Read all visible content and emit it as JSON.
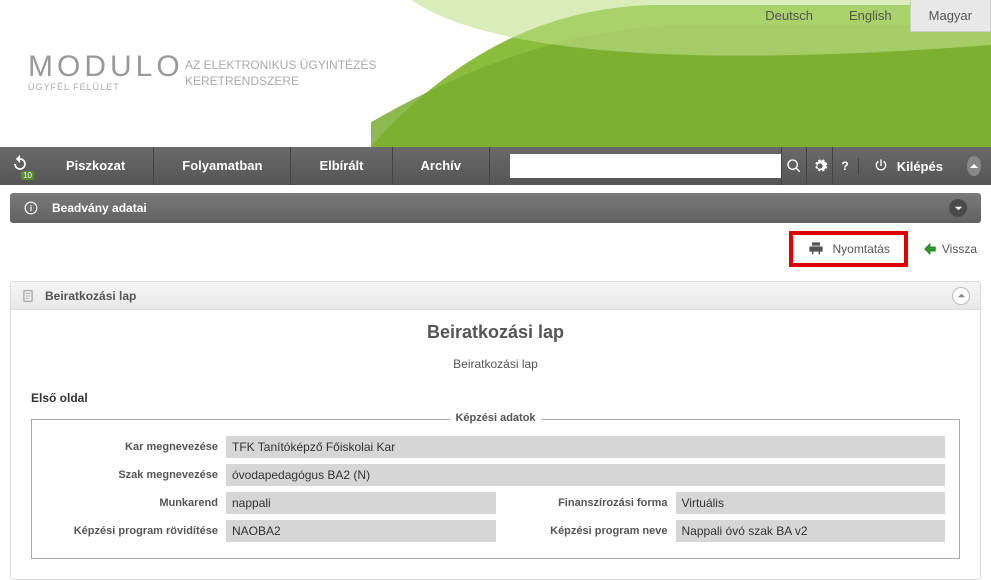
{
  "languages": {
    "de": "Deutsch",
    "en": "English",
    "hu": "Magyar",
    "active": "hu"
  },
  "logo": {
    "main": "MODULO",
    "sub": "ÜGYFÉL FELÜLET",
    "tagline_l1": "AZ ELEKTRONIKUS ÜGYINTÉZÉS",
    "tagline_l2": "KERETRENDSZERE"
  },
  "menu": {
    "items": [
      "Piszkozat",
      "Folyamatban",
      "Elbírált",
      "Archív"
    ],
    "logout": "Kilépés",
    "refresh_badge": "10",
    "search_value": ""
  },
  "section": {
    "title": "Beadvány adatai"
  },
  "actions": {
    "print": "Nyomtatás",
    "back": "Vissza"
  },
  "panel": {
    "title": "Beiratkozási lap"
  },
  "doc": {
    "title": "Beiratkozási lap",
    "subtitle": "Beiratkozási lap",
    "page_header": "Első oldal"
  },
  "fieldset": {
    "legend": "Képzési adatok"
  },
  "fields": {
    "kar": {
      "label": "Kar megnevezése",
      "value": "TFK Tanítóképző Főiskolai Kar"
    },
    "szak": {
      "label": "Szak megnevezése",
      "value": "óvodapedagógus BA2 (N)"
    },
    "munkarend": {
      "label": "Munkarend",
      "value": "nappali"
    },
    "finansz": {
      "label": "Finanszírozási forma",
      "value": "Virtuális"
    },
    "rovid": {
      "label": "Képzési program rövidítése",
      "value": "NAOBA2"
    },
    "progneve": {
      "label": "Képzési program neve",
      "value": "Nappali óvó szak BA v2"
    }
  }
}
